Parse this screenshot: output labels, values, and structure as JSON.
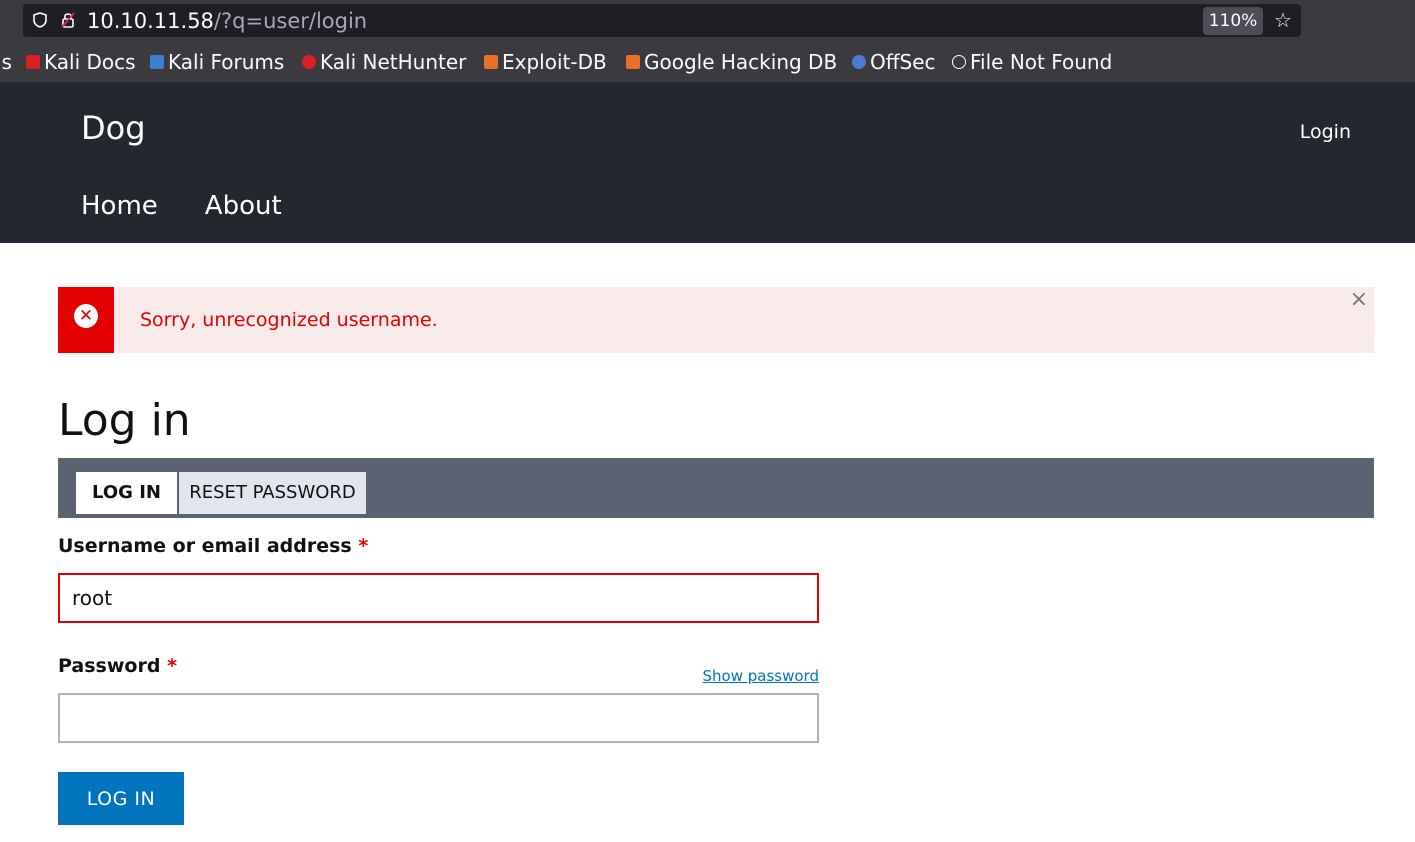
{
  "browser": {
    "url_host": "10.10.11.58",
    "url_path": "/?q=user/login",
    "zoom": "110%",
    "bookmarks": [
      {
        "label": "ls",
        "icon": "kali-icon"
      },
      {
        "label": "Kali Docs",
        "icon": "kali-docs-icon"
      },
      {
        "label": "Kali Forums",
        "icon": "kali-forums-icon"
      },
      {
        "label": "Kali NetHunter",
        "icon": "nethunter-icon"
      },
      {
        "label": "Exploit-DB",
        "icon": "exploit-db-icon"
      },
      {
        "label": "Google Hacking DB",
        "icon": "ghdb-icon"
      },
      {
        "label": "OffSec",
        "icon": "offsec-icon"
      },
      {
        "label": "File Not Found",
        "icon": "globe-icon"
      }
    ]
  },
  "site": {
    "name": "Dog",
    "login_link": "Login",
    "nav": [
      "Home",
      "About"
    ]
  },
  "message": {
    "text": "Sorry, unrecognized username.",
    "close": "×"
  },
  "page": {
    "title": "Log in",
    "tabs": [
      "LOG IN",
      "RESET PASSWORD"
    ]
  },
  "form": {
    "username_label": "Username or email address",
    "username_value": "root",
    "password_label": "Password",
    "password_value": "",
    "required_marker": "*",
    "show_password": "Show password",
    "submit_label": "LOG IN"
  },
  "colors": {
    "header_bg": "#23272e",
    "error_red": "#e20000",
    "message_bg": "#f8ebea",
    "tabs_bg": "#5b6373",
    "button_blue": "#0074bd"
  }
}
